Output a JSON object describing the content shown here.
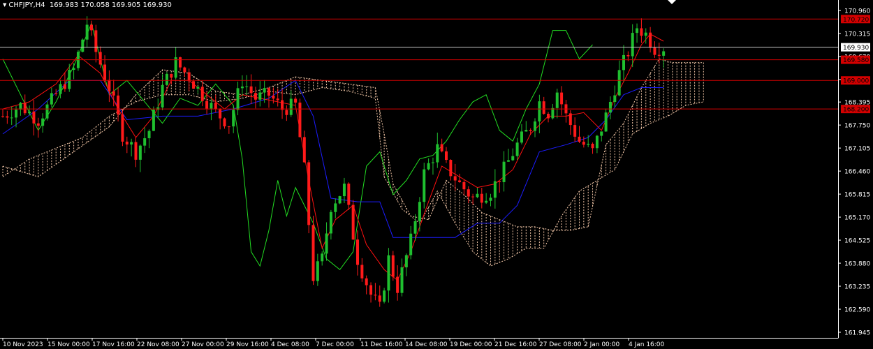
{
  "header": {
    "symbol": "CHFJPY,H4",
    "ohlc": "169.983 170.058 169.905 169.930",
    "icon": "triangle-down-icon"
  },
  "colors": {
    "background": "#000000",
    "bull": "#1fbf2f",
    "bear": "#ff1a1a",
    "tenkan": "#ff1010",
    "kijun": "#1c1cff",
    "chikou": "#22dd22",
    "cloud": "#f4c8a8",
    "level_line": "#d40000",
    "price_line": "#c8c8c8",
    "label_bg": "#d40000"
  },
  "chart_data": {
    "type": "candlestick",
    "title": "CHFJPY,H4",
    "ylim": [
      161.95,
      171.06
    ],
    "y_ticks": [
      "170.960",
      "170.315",
      "169.670",
      "169.025",
      "168.395",
      "167.750",
      "167.105",
      "166.460",
      "165.815",
      "165.170",
      "164.525",
      "163.880",
      "163.235",
      "162.590",
      "161.945"
    ],
    "x_ticks": [
      "10 Nov 2023",
      "15 Nov 00:00",
      "17 Nov 16:00",
      "22 Nov 08:00",
      "27 Nov 00:00",
      "29 Nov 16:00",
      "4 Dec 08:00",
      "7 Dec 00:00",
      "11 Dec 16:00",
      "14 Dec 08:00",
      "19 Dec 00:00",
      "21 Dec 16:00",
      "27 Dec 08:00",
      "2 Jan 00:00",
      "4 Jan 16:00"
    ],
    "levels": [
      {
        "value": 170.72,
        "label": "170.720"
      },
      {
        "value": 169.58,
        "label": "169.580"
      },
      {
        "value": 169.0,
        "label": "169.000"
      },
      {
        "value": 168.2,
        "label": "168.200"
      }
    ],
    "current_price": {
      "value": 169.93,
      "label": "169.930"
    },
    "cutoff_label": "169.670",
    "close_path": [
      [
        0,
        168.0
      ],
      [
        4,
        168.3
      ],
      [
        8,
        167.9
      ],
      [
        12,
        168.6
      ],
      [
        16,
        169.3
      ],
      [
        19,
        170.6
      ],
      [
        21,
        169.8
      ],
      [
        24,
        168.8
      ],
      [
        27,
        167.5
      ],
      [
        30,
        167.0
      ],
      [
        33,
        167.6
      ],
      [
        36,
        168.8
      ],
      [
        39,
        169.5
      ],
      [
        42,
        169.1
      ],
      [
        45,
        168.6
      ],
      [
        48,
        168.1
      ],
      [
        51,
        167.8
      ],
      [
        54,
        169.0
      ],
      [
        57,
        168.5
      ],
      [
        60,
        168.6
      ],
      [
        63,
        168.2
      ],
      [
        66,
        168.3
      ],
      [
        68,
        166.5
      ],
      [
        70,
        163.5
      ],
      [
        72,
        164.0
      ],
      [
        74,
        165.5
      ],
      [
        77,
        166.0
      ],
      [
        80,
        164.0
      ],
      [
        83,
        163.0
      ],
      [
        85,
        162.6
      ],
      [
        87,
        164.0
      ],
      [
        89,
        163.2
      ],
      [
        92,
        164.5
      ],
      [
        95,
        166.4
      ],
      [
        98,
        167.1
      ],
      [
        100,
        166.6
      ],
      [
        103,
        166.1
      ],
      [
        106,
        165.7
      ],
      [
        110,
        165.9
      ],
      [
        113,
        166.5
      ],
      [
        116,
        167.2
      ],
      [
        119,
        167.7
      ],
      [
        121,
        168.4
      ],
      [
        123,
        168.1
      ],
      [
        125,
        168.7
      ],
      [
        127,
        168.0
      ],
      [
        130,
        167.3
      ],
      [
        133,
        167.0
      ],
      [
        136,
        168.0
      ],
      [
        139,
        169.2
      ],
      [
        141,
        169.8
      ],
      [
        143,
        170.5
      ],
      [
        145,
        170.3
      ],
      [
        147,
        169.9
      ],
      [
        149,
        169.93
      ]
    ],
    "tenkan": [
      [
        0,
        168.2
      ],
      [
        6,
        168.4
      ],
      [
        12,
        168.9
      ],
      [
        17,
        169.7
      ],
      [
        22,
        169.2
      ],
      [
        26,
        168.2
      ],
      [
        30,
        167.4
      ],
      [
        34,
        168.0
      ],
      [
        38,
        169.0
      ],
      [
        42,
        169.0
      ],
      [
        46,
        168.6
      ],
      [
        50,
        168.2
      ],
      [
        54,
        168.6
      ],
      [
        58,
        168.5
      ],
      [
        62,
        168.4
      ],
      [
        66,
        168.3
      ],
      [
        69,
        166.2
      ],
      [
        72,
        164.3
      ],
      [
        75,
        165.1
      ],
      [
        79,
        165.5
      ],
      [
        82,
        164.4
      ],
      [
        86,
        163.7
      ],
      [
        89,
        163.4
      ],
      [
        92,
        164.2
      ],
      [
        96,
        165.6
      ],
      [
        99,
        166.6
      ],
      [
        103,
        166.3
      ],
      [
        107,
        166.0
      ],
      [
        111,
        166.1
      ],
      [
        115,
        166.5
      ],
      [
        119,
        167.5
      ],
      [
        123,
        168.0
      ],
      [
        127,
        168.0
      ],
      [
        131,
        168.1
      ],
      [
        135,
        167.6
      ],
      [
        138,
        168.5
      ],
      [
        141,
        169.2
      ],
      [
        144,
        170.0
      ],
      [
        146,
        170.3
      ],
      [
        149,
        170.1
      ]
    ],
    "kijun": [
      [
        0,
        167.5
      ],
      [
        8,
        168.2
      ],
      [
        15,
        169.0
      ],
      [
        22,
        169.0
      ],
      [
        28,
        167.9
      ],
      [
        36,
        168.0
      ],
      [
        44,
        168.0
      ],
      [
        52,
        168.2
      ],
      [
        60,
        168.5
      ],
      [
        66,
        169.0
      ],
      [
        70,
        168.0
      ],
      [
        74,
        165.7
      ],
      [
        80,
        165.6
      ],
      [
        85,
        165.6
      ],
      [
        88,
        164.6
      ],
      [
        96,
        164.6
      ],
      [
        102,
        164.6
      ],
      [
        107,
        165.0
      ],
      [
        112,
        165.0
      ],
      [
        116,
        165.5
      ],
      [
        121,
        167.0
      ],
      [
        127,
        167.2
      ],
      [
        132,
        167.4
      ],
      [
        136,
        167.9
      ],
      [
        140,
        168.6
      ],
      [
        144,
        168.8
      ],
      [
        149,
        168.8
      ]
    ],
    "chikou": [
      [
        0,
        169.6
      ],
      [
        4,
        168.6
      ],
      [
        8,
        167.6
      ],
      [
        12,
        168.4
      ],
      [
        16,
        169.4
      ],
      [
        20,
        170.6
      ],
      [
        24,
        168.6
      ],
      [
        28,
        169.0
      ],
      [
        32,
        168.4
      ],
      [
        36,
        167.8
      ],
      [
        40,
        168.5
      ],
      [
        44,
        168.3
      ],
      [
        48,
        168.9
      ],
      [
        52,
        168.3
      ],
      [
        54,
        166.8
      ],
      [
        56,
        164.2
      ],
      [
        58,
        163.8
      ],
      [
        60,
        164.8
      ],
      [
        62,
        166.2
      ],
      [
        64,
        165.2
      ],
      [
        66,
        166.0
      ],
      [
        70,
        165.0
      ],
      [
        73,
        164.0
      ],
      [
        76,
        163.7
      ],
      [
        79,
        164.2
      ],
      [
        82,
        166.6
      ],
      [
        85,
        167.0
      ],
      [
        88,
        165.8
      ],
      [
        91,
        166.2
      ],
      [
        94,
        166.8
      ],
      [
        97,
        166.9
      ],
      [
        100,
        167.3
      ],
      [
        103,
        167.9
      ],
      [
        106,
        168.4
      ],
      [
        109,
        168.6
      ],
      [
        112,
        167.6
      ],
      [
        115,
        167.3
      ],
      [
        118,
        168.2
      ],
      [
        121,
        168.9
      ],
      [
        124,
        170.4
      ],
      [
        127,
        170.4
      ],
      [
        130,
        169.6
      ],
      [
        133,
        170.0
      ]
    ],
    "cloud_a": [
      [
        0,
        166.6
      ],
      [
        8,
        166.3
      ],
      [
        16,
        167.0
      ],
      [
        24,
        167.7
      ],
      [
        30,
        168.6
      ],
      [
        36,
        169.3
      ],
      [
        42,
        169.2
      ],
      [
        48,
        168.7
      ],
      [
        54,
        168.6
      ],
      [
        60,
        168.8
      ],
      [
        66,
        169.1
      ],
      [
        72,
        169.0
      ],
      [
        78,
        168.9
      ],
      [
        84,
        168.8
      ],
      [
        86,
        167.5
      ],
      [
        88,
        166.1
      ],
      [
        92,
        165.2
      ],
      [
        96,
        165.1
      ],
      [
        100,
        166.2
      ],
      [
        104,
        165.8
      ],
      [
        108,
        165.3
      ],
      [
        112,
        165.1
      ],
      [
        116,
        164.9
      ],
      [
        120,
        164.9
      ],
      [
        124,
        164.8
      ],
      [
        128,
        164.8
      ],
      [
        132,
        164.9
      ],
      [
        136,
        167.2
      ],
      [
        140,
        167.8
      ],
      [
        144,
        168.8
      ],
      [
        148,
        169.6
      ],
      [
        151,
        169.5
      ],
      [
        154,
        169.5
      ],
      [
        158,
        169.5
      ]
    ],
    "cloud_b": [
      [
        0,
        166.3
      ],
      [
        6,
        166.8
      ],
      [
        12,
        167.1
      ],
      [
        18,
        167.4
      ],
      [
        24,
        168.0
      ],
      [
        30,
        168.4
      ],
      [
        36,
        168.6
      ],
      [
        42,
        168.6
      ],
      [
        48,
        168.4
      ],
      [
        54,
        168.5
      ],
      [
        60,
        168.7
      ],
      [
        66,
        168.6
      ],
      [
        72,
        168.8
      ],
      [
        78,
        168.7
      ],
      [
        84,
        168.5
      ],
      [
        86,
        166.3
      ],
      [
        90,
        165.4
      ],
      [
        94,
        165.0
      ],
      [
        98,
        165.9
      ],
      [
        102,
        165.0
      ],
      [
        106,
        164.2
      ],
      [
        110,
        163.8
      ],
      [
        114,
        164.0
      ],
      [
        118,
        164.3
      ],
      [
        122,
        164.3
      ],
      [
        126,
        165.2
      ],
      [
        130,
        165.9
      ],
      [
        134,
        166.2
      ],
      [
        138,
        166.5
      ],
      [
        142,
        167.5
      ],
      [
        146,
        167.8
      ],
      [
        150,
        168.0
      ],
      [
        154,
        168.3
      ],
      [
        158,
        168.4
      ]
    ]
  }
}
